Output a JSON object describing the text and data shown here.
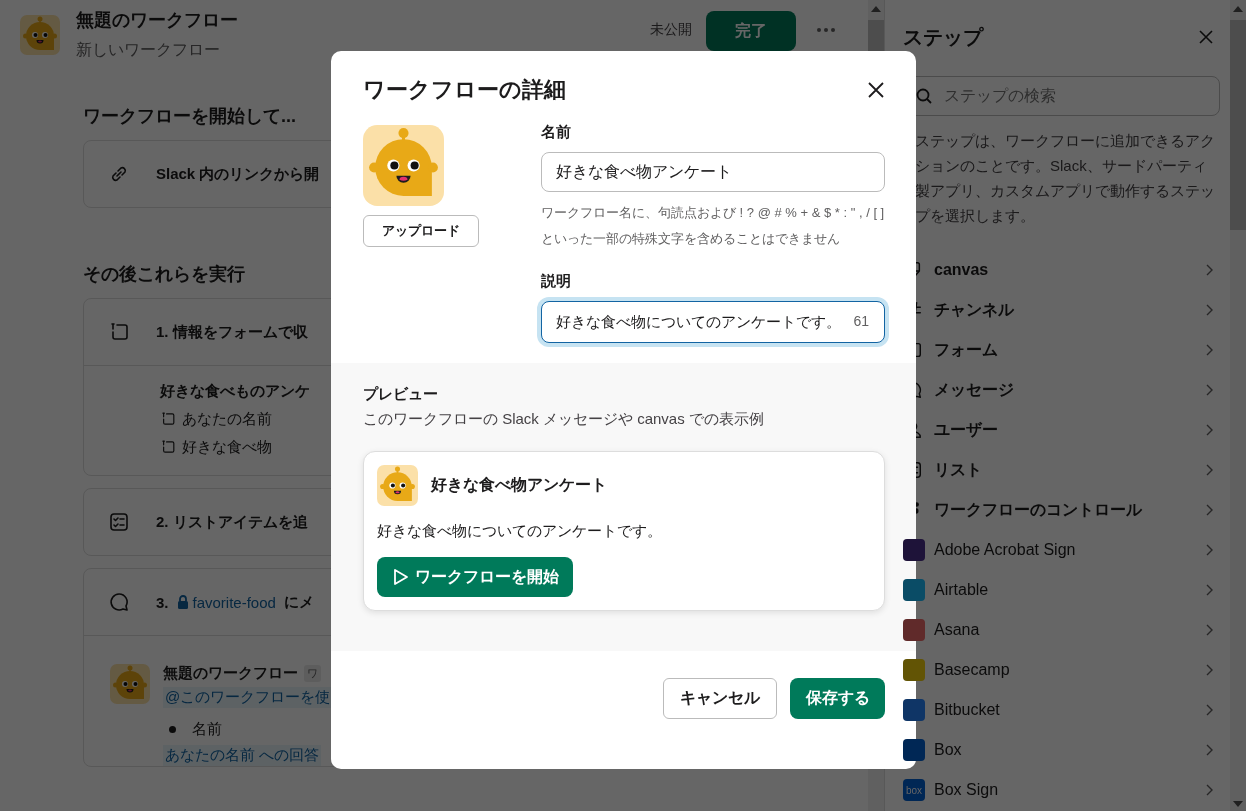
{
  "header": {
    "title": "無題のワークフロー",
    "subtitle": "新しいワークフロー",
    "status": "未公開",
    "done_button": "完了"
  },
  "workflow": {
    "trigger_heading": "ワークフローを開始して...",
    "trigger": "Slack 内のリンクから開",
    "steps_heading": "その後これらを実行",
    "steps": [
      {
        "kind": "form",
        "title": "1. 情報をフォームで収",
        "form_title": "好きな食べものアンケ",
        "fields": [
          "あなたの名前",
          "好きな食べ物"
        ]
      },
      {
        "kind": "list",
        "title": "2. リストアイテムを追"
      },
      {
        "kind": "message",
        "number": "3.",
        "channel": "favorite-food",
        "suffix": "にメ",
        "message": {
          "sender": "無題のワークフロー",
          "tag": "ワ",
          "mention": "@このワークフローを使",
          "bullet": "名前",
          "answer": "あなたの名前 への回答"
        }
      }
    ]
  },
  "steps_panel": {
    "title": "ステップ",
    "search": {
      "placeholder": "ステップの検索"
    },
    "description": "ステップは、ワークフローに追加できるアクションのことです。Slack、サードパーティ製アプリ、カスタムアプリで動作するステップを選択します。",
    "items": [
      {
        "kind": "canvas",
        "label": "canvas"
      },
      {
        "kind": "channel",
        "label": "チャンネル"
      },
      {
        "kind": "form",
        "label": "フォーム"
      },
      {
        "kind": "message",
        "label": "メッセージ"
      },
      {
        "kind": "user",
        "label": "ユーザー"
      },
      {
        "kind": "list",
        "label": "リスト"
      },
      {
        "kind": "control",
        "label": "ワークフローのコントロール"
      },
      {
        "kind": "app",
        "label": "Adobe Acrobat Sign",
        "color": "#1e1339"
      },
      {
        "kind": "app",
        "label": "Airtable",
        "color": "#0a4c66"
      },
      {
        "kind": "app",
        "label": "Asana",
        "color": "#602a2a"
      },
      {
        "kind": "app",
        "label": "Basecamp",
        "color": "#625405"
      },
      {
        "kind": "app",
        "label": "Bitbucket",
        "color": "#0f3566"
      },
      {
        "kind": "app",
        "label": "Box",
        "color": "#002755"
      },
      {
        "kind": "app",
        "label": "Box Sign",
        "color": "#002755",
        "logo_text": "box"
      }
    ]
  },
  "dialog": {
    "title": "ワークフローの詳細",
    "upload_button": "アップロード",
    "name": {
      "label": "名前",
      "value": "好きな食べ物アンケート",
      "hint": "ワークフロー名に、句読点および ! ? @ # % + & $ * : \" , / [ ] といった一部の特殊文字を含めることはできません"
    },
    "description": {
      "label": "説明",
      "value": "好きな食べ物についてのアンケートです。",
      "count": "61",
      "focused": true
    },
    "preview": {
      "heading": "プレビュー",
      "subtitle": "このワークフローの Slack メッセージや canvas での表示例",
      "card_title": "好きな食べ物アンケート",
      "card_text": "好きな食べ物についてのアンケートです。",
      "start_button": "ワークフローを開始"
    },
    "cancel_button": "キャンセル",
    "save_button": "保存する"
  }
}
